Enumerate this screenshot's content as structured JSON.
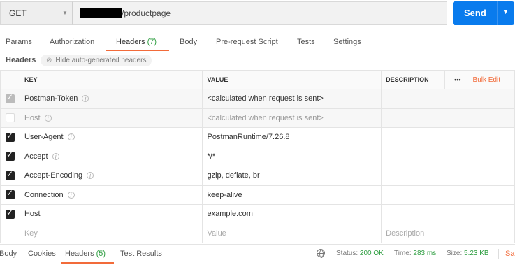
{
  "request": {
    "method": "GET",
    "url_suffix": "/productpage",
    "send_label": "Send"
  },
  "tabs": [
    {
      "label": "Params"
    },
    {
      "label": "Authorization"
    },
    {
      "label": "Headers",
      "count": "(7)"
    },
    {
      "label": "Body"
    },
    {
      "label": "Pre-request Script"
    },
    {
      "label": "Tests"
    },
    {
      "label": "Settings"
    }
  ],
  "headers_section": {
    "title": "Headers",
    "hide_label": "Hide auto-generated headers"
  },
  "table": {
    "columns": {
      "key": "KEY",
      "value": "VALUE",
      "description": "DESCRIPTION",
      "more": "•••",
      "bulk_edit": "Bulk Edit"
    },
    "rows": [
      {
        "key": "Postman-Token",
        "value": "<calculated when request is sent>",
        "state": "grey"
      },
      {
        "key": "Host",
        "value": "<calculated when request is sent>",
        "state": "off"
      },
      {
        "key": "User-Agent",
        "value": "PostmanRuntime/7.26.8",
        "state": "on"
      },
      {
        "key": "Accept",
        "value": "*/*",
        "state": "on"
      },
      {
        "key": "Accept-Encoding",
        "value": "gzip, deflate, br",
        "state": "on"
      },
      {
        "key": "Connection",
        "value": "keep-alive",
        "state": "on"
      },
      {
        "key": "Host",
        "value": "example.com",
        "state": "on"
      }
    ],
    "placeholder": {
      "key": "Key",
      "value": "Value",
      "description": "Description"
    }
  },
  "response": {
    "tabs": [
      {
        "label": "Body"
      },
      {
        "label": "Cookies"
      },
      {
        "label": "Headers",
        "count": "(5)"
      },
      {
        "label": "Test Results"
      }
    ],
    "status_label": "Status:",
    "status_value": "200 OK",
    "time_label": "Time:",
    "time_value": "283 ms",
    "size_label": "Size:",
    "size_value": "5.23 KB",
    "save_label": "Sav"
  },
  "colors": {
    "accent": "#f26b3a",
    "send": "#097bed",
    "ok": "#2c9d3f"
  }
}
